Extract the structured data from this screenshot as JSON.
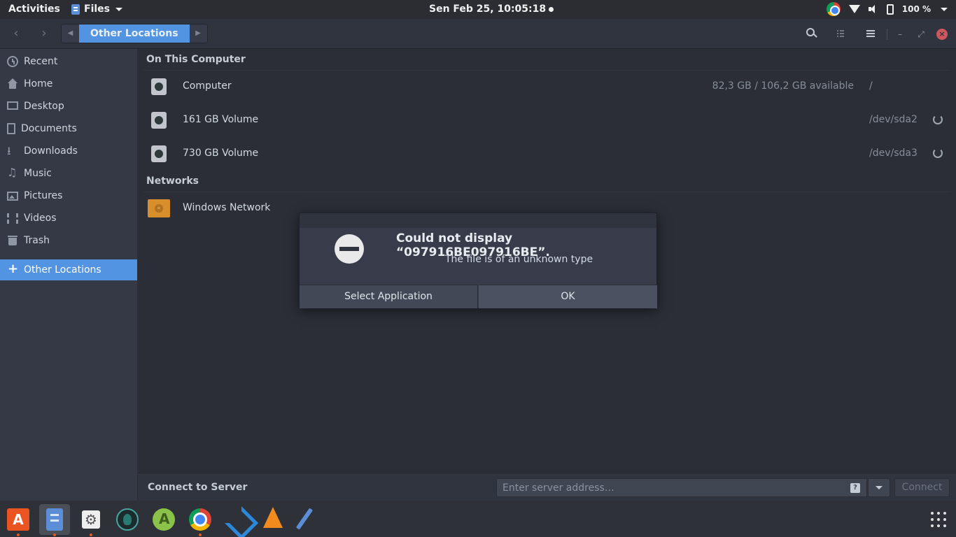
{
  "topbar": {
    "activities": "Activities",
    "app_menu": "Files",
    "clock": "Sen Feb 25, 10:05:18",
    "battery": "100 %"
  },
  "headerbar": {
    "current_location": "Other Locations"
  },
  "sidebar": {
    "items": [
      {
        "label": "Recent",
        "icon": "clock-icon"
      },
      {
        "label": "Home",
        "icon": "home-icon"
      },
      {
        "label": "Desktop",
        "icon": "desktop-icon"
      },
      {
        "label": "Documents",
        "icon": "document-icon"
      },
      {
        "label": "Downloads",
        "icon": "download-icon"
      },
      {
        "label": "Music",
        "icon": "music-icon"
      },
      {
        "label": "Pictures",
        "icon": "pictures-icon"
      },
      {
        "label": "Videos",
        "icon": "videos-icon"
      },
      {
        "label": "Trash",
        "icon": "trash-icon"
      }
    ],
    "other_locations": "Other Locations"
  },
  "main": {
    "on_this_computer": "On This Computer",
    "devices": [
      {
        "name": "Computer",
        "info": "82,3 GB / 106,2 GB available",
        "path": "/"
      },
      {
        "name": "161 GB Volume",
        "info": "",
        "path": "/dev/sda2"
      },
      {
        "name": "730 GB Volume",
        "info": "",
        "path": "/dev/sda3"
      }
    ],
    "networks": "Networks",
    "network_items": [
      {
        "name": "Windows Network"
      }
    ]
  },
  "connect": {
    "label": "Connect to Server",
    "placeholder": "Enter server address…",
    "button": "Connect"
  },
  "dialog": {
    "title": "Could not display “097916BE097916BE”.",
    "message": "The file is of an unknown type",
    "select_app": "Select Application",
    "ok": "OK"
  },
  "colors": {
    "accent": "#5294e2",
    "close": "#cc575d",
    "ubuntu_orange": "#e95420"
  },
  "dock": {
    "apps": [
      "ubuntu-software-icon",
      "files-icon",
      "settings-icon",
      "gitkraken-icon",
      "android-studio-icon",
      "chrome-icon",
      "vscode-icon",
      "vlc-icon",
      "color-picker-icon"
    ]
  }
}
